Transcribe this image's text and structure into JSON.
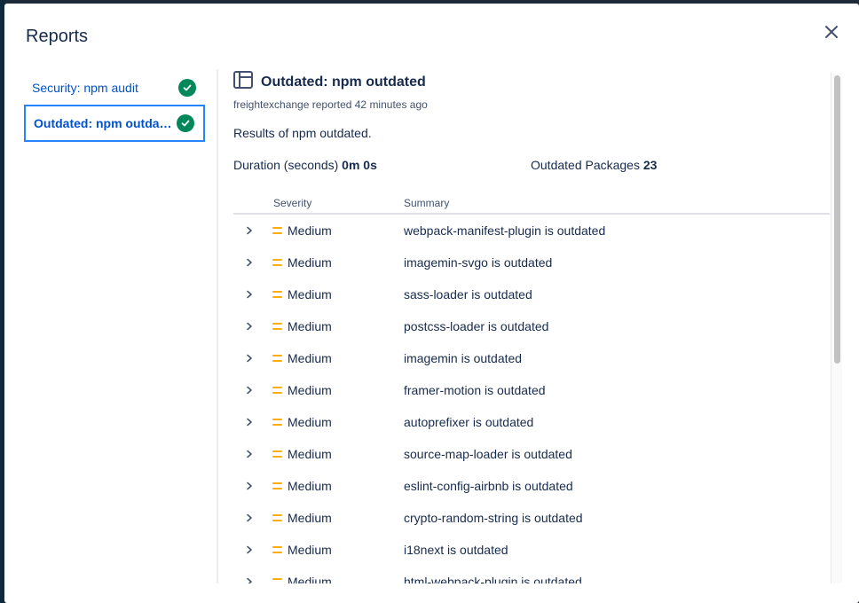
{
  "modal": {
    "title": "Reports",
    "close_icon": "close-icon"
  },
  "sidebar": {
    "items": [
      {
        "label": "Security: npm audit",
        "status_icon": "check-circle-icon",
        "active": false
      },
      {
        "label": "Outdated: npm outdated",
        "status_icon": "check-circle-icon",
        "active": true
      }
    ]
  },
  "report": {
    "icon": "panel-layout-icon",
    "title": "Outdated: npm outdated",
    "meta": "freightexchange reported 42 minutes ago",
    "description": "Results of npm outdated.",
    "stats": {
      "duration_label": "Duration (seconds)",
      "duration_value": "0m 0s",
      "packages_label": "Outdated Packages",
      "packages_value": "23"
    },
    "table": {
      "columns": [
        "Severity",
        "Summary"
      ],
      "rows": [
        {
          "severity": "Medium",
          "summary": "webpack-manifest-plugin is outdated"
        },
        {
          "severity": "Medium",
          "summary": "imagemin-svgo is outdated"
        },
        {
          "severity": "Medium",
          "summary": "sass-loader is outdated"
        },
        {
          "severity": "Medium",
          "summary": "postcss-loader is outdated"
        },
        {
          "severity": "Medium",
          "summary": "imagemin is outdated"
        },
        {
          "severity": "Medium",
          "summary": "framer-motion is outdated"
        },
        {
          "severity": "Medium",
          "summary": "autoprefixer is outdated"
        },
        {
          "severity": "Medium",
          "summary": "source-map-loader is outdated"
        },
        {
          "severity": "Medium",
          "summary": "eslint-config-airbnb is outdated"
        },
        {
          "severity": "Medium",
          "summary": "crypto-random-string is outdated"
        },
        {
          "severity": "Medium",
          "summary": "i18next is outdated"
        },
        {
          "severity": "Medium",
          "summary": "html-webpack-plugin is outdated"
        }
      ]
    }
  },
  "colors": {
    "link": "#0052cc",
    "success": "#00875a",
    "medium_severity": "#ffab00",
    "focus_border": "#2684ff"
  }
}
